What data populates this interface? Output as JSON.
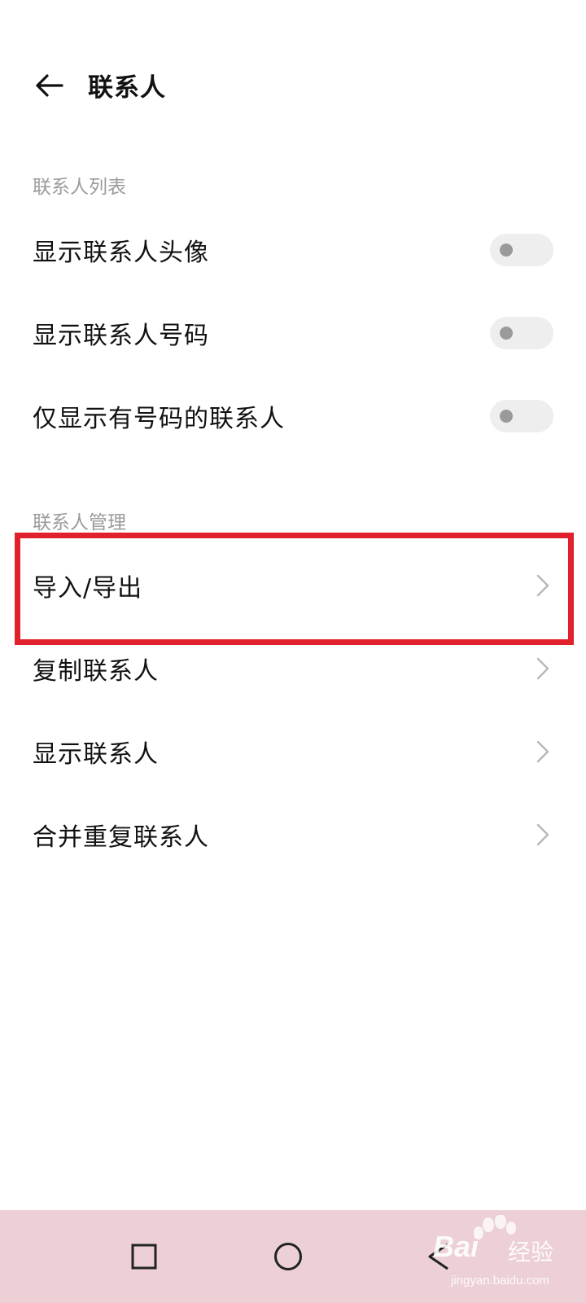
{
  "header": {
    "title": "联系人",
    "back_icon": "back-arrow-icon"
  },
  "sections": [
    {
      "title": "联系人列表",
      "items": [
        {
          "label": "显示联系人头像",
          "control": "toggle",
          "value": false
        },
        {
          "label": "显示联系人号码",
          "control": "toggle",
          "value": false
        },
        {
          "label": "仅显示有号码的联系人",
          "control": "toggle",
          "value": false
        }
      ]
    },
    {
      "title": "联系人管理",
      "items": [
        {
          "label": "导入/导出",
          "control": "chevron",
          "highlighted": true
        },
        {
          "label": "复制联系人",
          "control": "chevron"
        },
        {
          "label": "显示联系人",
          "control": "chevron"
        },
        {
          "label": "合并重复联系人",
          "control": "chevron"
        }
      ]
    }
  ],
  "navigation_bar": {
    "buttons": [
      "recent-apps-icon",
      "home-icon",
      "back-icon"
    ]
  },
  "watermark": {
    "brand": "Bai",
    "brand_suffix": "经验",
    "url": "jingyan.baidu.com"
  },
  "colors": {
    "highlight": "#e0212b",
    "section_title": "#9b9b9b",
    "nav_bar": "#ecd0d6"
  }
}
